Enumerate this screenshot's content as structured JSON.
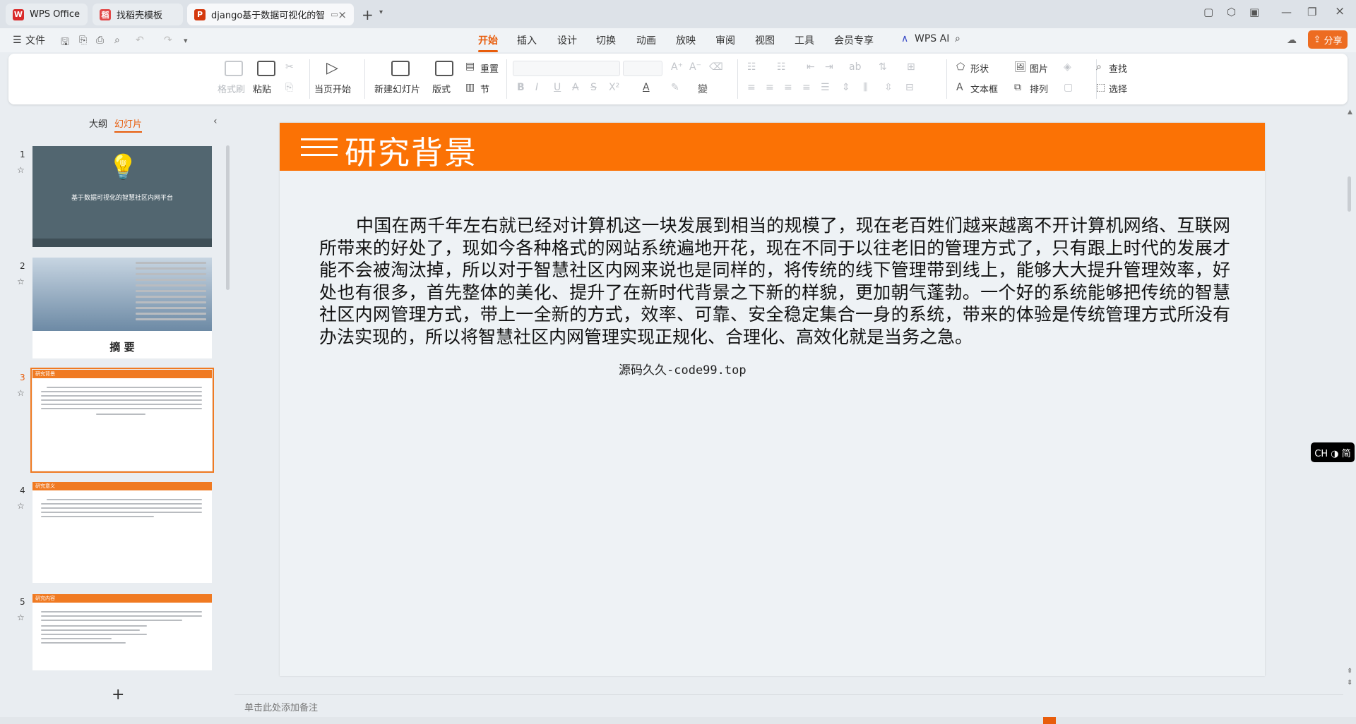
{
  "tabs": [
    {
      "label": "WPS Office",
      "icon": "wps-logo"
    },
    {
      "label": "找稻壳模板",
      "icon": "docer-logo"
    },
    {
      "label": "django基于数据可视化的智",
      "icon": "ppt-logo"
    }
  ],
  "menu": {
    "file": "文件",
    "items": [
      "开始",
      "插入",
      "设计",
      "切换",
      "动画",
      "放映",
      "审阅",
      "视图",
      "工具",
      "会员专享"
    ],
    "active": "开始",
    "wps_ai": "WPS AI",
    "share": "分享"
  },
  "ribbon": {
    "format_painter": "格式刷",
    "paste": "粘贴",
    "play_from_current": "当页开始",
    "new_slide": "新建幻灯片",
    "layout": "版式",
    "section": "节",
    "reset": "重置",
    "shape": "形状",
    "picture": "图片",
    "find": "查找",
    "textbox": "文本框",
    "arrange": "排列",
    "select": "选择"
  },
  "panel": {
    "outline_tab": "大纲",
    "slides_tab": "幻灯片",
    "slide_numbers": [
      "1",
      "2",
      "3",
      "4",
      "5"
    ],
    "thumb1_title": "基于数据可视化的智慧社区内网平台",
    "thumb2_title": "摘 要",
    "thumb3_title": "研究背景",
    "thumb4_title": "研究意义",
    "thumb5_title": "研究内容"
  },
  "slide": {
    "title": "研究背景",
    "body": "中国在两千年左右就已经对计算机这一块发展到相当的规模了，现在老百姓们越来越离不开计算机网络、互联网所带来的好处了，现如今各种格式的网站系统遍地开花，现在不同于以往老旧的管理方式了，只有跟上时代的发展才能不会被淘汰掉，所以对于智慧社区内网来说也是同样的，将传统的线下管理带到线上，能够大大提升管理效率，好处也有很多，首先整体的美化、提升了在新时代背景之下新的样貌，更加朝气蓬勃。一个好的系统能够把传统的智慧社区内网管理方式，带上一全新的方式，效率、可靠、安全稳定集合一身的系统，带来的体验是传统管理方式所没有办法实现的，所以将智慧社区内网管理实现正规化、合理化、高效化就是当务之急。",
    "watermark": "源码久久-code99.top"
  },
  "notes_placeholder": "单击此处添加备注",
  "ime": "CH ◑ 简",
  "colors": {
    "accent": "#fb7205",
    "tab_accent": "#e85d0c"
  }
}
